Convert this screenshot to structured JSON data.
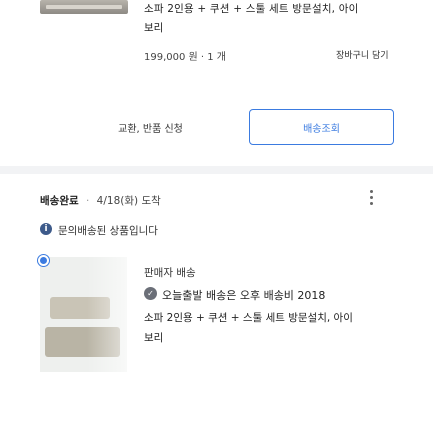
{
  "top_item": {
    "title_line1": "소파 2인용 + 쿠션 + 스툴 세트 방문설치, 아이",
    "title_line2": "보리",
    "price": "199,000 원 · 1 개",
    "cart_link": "장바구니 담기"
  },
  "actions": {
    "return_label": "교환, 반품 신청",
    "track_label": "배송조회"
  },
  "shipment": {
    "status": "배송완료",
    "separator": "·",
    "date": "4/18(화) 도착"
  },
  "notice": {
    "icon": "i",
    "text": "문의배송된 상품입니다"
  },
  "product": {
    "seller": "판매자 배송",
    "detail_icon": "✓",
    "detail_text": "오늘출발 배송은 오후 배송비 2018",
    "title_line1": "소파 2인용 + 쿠션 + 스툴 세트 방문설치, 아이",
    "title_line2": "보리"
  },
  "colors": {
    "accent": "#3b7be0",
    "divider": "#f2f3f5"
  }
}
